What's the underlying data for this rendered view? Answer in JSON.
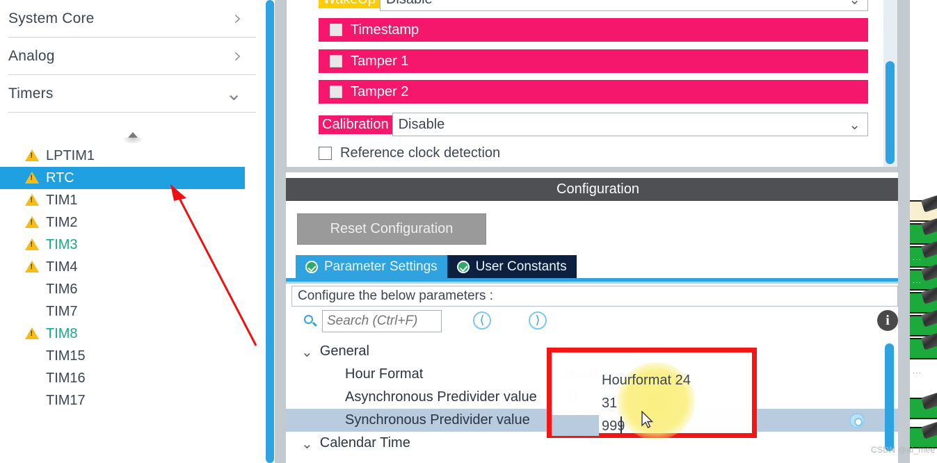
{
  "sidebar": {
    "categories": [
      {
        "label": "System Core",
        "chevron": "chevron-right-icon",
        "expanded": false
      },
      {
        "label": "Analog",
        "chevron": "chevron-right-icon",
        "expanded": false
      },
      {
        "label": "Timers",
        "chevron": "chevron-down-icon",
        "expanded": true
      }
    ],
    "peripherals": [
      {
        "label": "LPTIM1",
        "warning": true,
        "selected": false,
        "state": "default"
      },
      {
        "label": "RTC",
        "warning": true,
        "selected": true,
        "state": "default"
      },
      {
        "label": "TIM1",
        "warning": true,
        "selected": false,
        "state": "default"
      },
      {
        "label": "TIM2",
        "warning": true,
        "selected": false,
        "state": "default"
      },
      {
        "label": "TIM3",
        "warning": true,
        "selected": false,
        "state": "configured"
      },
      {
        "label": "TIM4",
        "warning": true,
        "selected": false,
        "state": "default"
      },
      {
        "label": "TIM6",
        "warning": false,
        "selected": false,
        "state": "default"
      },
      {
        "label": "TIM7",
        "warning": false,
        "selected": false,
        "state": "default"
      },
      {
        "label": "TIM8",
        "warning": true,
        "selected": false,
        "state": "configured"
      },
      {
        "label": "TIM15",
        "warning": false,
        "selected": false,
        "state": "default"
      },
      {
        "label": "TIM16",
        "warning": false,
        "selected": false,
        "state": "default"
      },
      {
        "label": "TIM17",
        "warning": false,
        "selected": false,
        "state": "default"
      }
    ]
  },
  "mode_panel": {
    "wakeup": {
      "label": "WakeUp",
      "value": "Disable"
    },
    "checkboxes": [
      {
        "label": "Timestamp",
        "checked": false
      },
      {
        "label": "Tamper 1",
        "checked": false
      },
      {
        "label": "Tamper 2",
        "checked": false
      }
    ],
    "calibration": {
      "label": "Calibration",
      "value": "Disable"
    },
    "reference_clock": {
      "label": "Reference clock detection",
      "checked": false
    }
  },
  "configuration": {
    "title": "Configuration",
    "reset_button": "Reset Configuration",
    "tabs": [
      {
        "label": "Parameter Settings",
        "active": true,
        "icon": "check-circle-icon"
      },
      {
        "label": "User Constants",
        "active": false,
        "icon": "check-circle-icon"
      }
    ],
    "configure_hint": "Configure the below parameters :",
    "search": {
      "placeholder": "Search (Ctrl+F)",
      "value": "",
      "icon": "search-icon",
      "prev_icon": "nav-prev-icon",
      "next_icon": "nav-next-icon",
      "info_icon": "info-icon"
    },
    "tree": {
      "groups": [
        {
          "name": "General",
          "expanded": true,
          "rows": [
            {
              "name": "Hour Format",
              "value": "Hourformat 24",
              "selected": false,
              "editing": false
            },
            {
              "name": "Asynchronous Predivider value",
              "value": "31",
              "selected": false,
              "editing": false
            },
            {
              "name": "Synchronous Predivider value",
              "value": "999",
              "selected": true,
              "editing": true,
              "gear": "gear-icon"
            }
          ]
        },
        {
          "name": "Calendar Time",
          "expanded": true,
          "rows": []
        }
      ]
    }
  },
  "annotation": {
    "arrow": "red-arrow-pointing-to-rtc",
    "highlight_box": "red-rectangle-around-general-values",
    "cursor": "mouse-pointer",
    "highlight_circle": "yellow-click-highlight"
  },
  "watermark": {
    "text": "CSDN @ai_mee"
  },
  "colors": {
    "selection_blue": "#1fa0e0",
    "pink": "#f4176c",
    "yellow_tag": "#ffcc00",
    "warning_yellow": "#f5bc1a",
    "configured_green": "#1aa88a",
    "header_gray": "#4e5053",
    "tab_active": "#2fa3e0",
    "tab_inactive": "#0d2040",
    "row_selected": "#b9cbdf",
    "annotation_red": "#f41515",
    "pin_green": "#1caa3c",
    "pin_beige": "#f7efd0"
  }
}
